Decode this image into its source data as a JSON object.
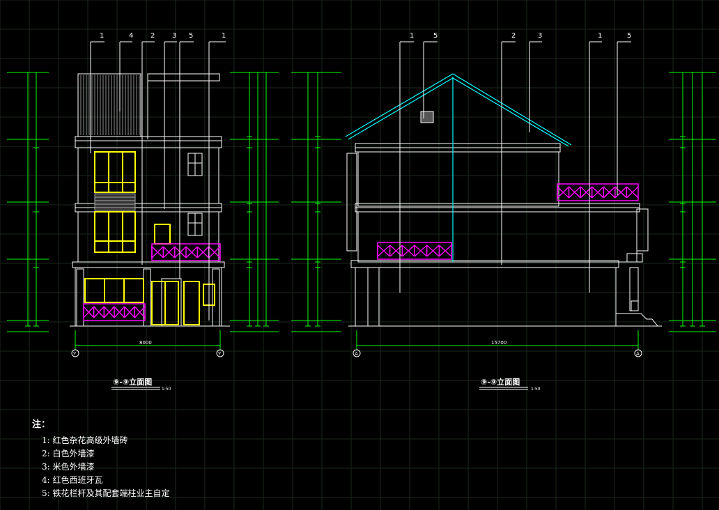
{
  "callouts": {
    "left": [
      "1",
      "4",
      "2",
      "3",
      "5",
      "1"
    ],
    "right": [
      "1",
      "5",
      "2",
      "3",
      "1",
      "5"
    ]
  },
  "dimensions": {
    "left_total_width": "8000",
    "right_total_width": "15700",
    "left_axis_a": "Y",
    "left_axis_b": "Y",
    "right_axis_a": "A",
    "right_axis_b": "A"
  },
  "titles": {
    "left": "⑨-⑨立面图",
    "left_scale": "1:50",
    "right": "⑨-⑨立面图",
    "right_scale": "1:50"
  },
  "notes": {
    "heading": "注：",
    "items": [
      "1: 红色杂花高级外墙砖",
      "2: 白色外墙漆",
      "3: 米色外墙漆",
      "4: 红色西班牙瓦",
      "5: 铁花栏杆及其配套端柱业主自定"
    ]
  },
  "colors": {
    "background": "#000000",
    "grid": "#1e2a1e",
    "outline": "#ffffff",
    "dimension": "#00ff00",
    "window": "#ffff00",
    "railing": "#ff00ff",
    "roof": "#00ffff"
  }
}
